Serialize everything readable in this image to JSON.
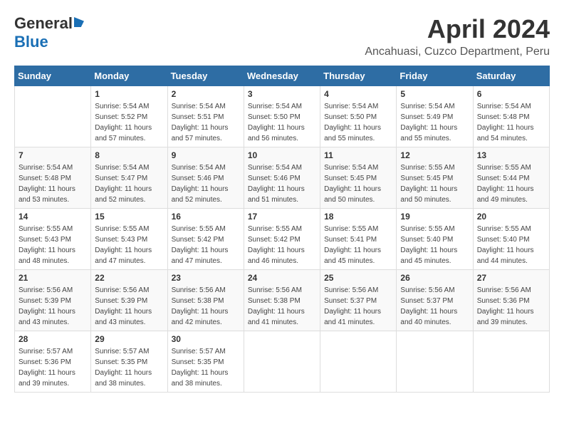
{
  "header": {
    "logo": {
      "part1": "General",
      "part2": "Blue"
    },
    "title": "April 2024",
    "location": "Ancahuasi, Cuzco Department, Peru"
  },
  "calendar": {
    "weekdays": [
      "Sunday",
      "Monday",
      "Tuesday",
      "Wednesday",
      "Thursday",
      "Friday",
      "Saturday"
    ],
    "weeks": [
      [
        {
          "day": null
        },
        {
          "day": 1,
          "sunrise": "5:54 AM",
          "sunset": "5:52 PM",
          "daylight": "11 hours and 57 minutes."
        },
        {
          "day": 2,
          "sunrise": "5:54 AM",
          "sunset": "5:51 PM",
          "daylight": "11 hours and 57 minutes."
        },
        {
          "day": 3,
          "sunrise": "5:54 AM",
          "sunset": "5:50 PM",
          "daylight": "11 hours and 56 minutes."
        },
        {
          "day": 4,
          "sunrise": "5:54 AM",
          "sunset": "5:50 PM",
          "daylight": "11 hours and 55 minutes."
        },
        {
          "day": 5,
          "sunrise": "5:54 AM",
          "sunset": "5:49 PM",
          "daylight": "11 hours and 55 minutes."
        },
        {
          "day": 6,
          "sunrise": "5:54 AM",
          "sunset": "5:48 PM",
          "daylight": "11 hours and 54 minutes."
        }
      ],
      [
        {
          "day": 7,
          "sunrise": "5:54 AM",
          "sunset": "5:48 PM",
          "daylight": "11 hours and 53 minutes."
        },
        {
          "day": 8,
          "sunrise": "5:54 AM",
          "sunset": "5:47 PM",
          "daylight": "11 hours and 52 minutes."
        },
        {
          "day": 9,
          "sunrise": "5:54 AM",
          "sunset": "5:46 PM",
          "daylight": "11 hours and 52 minutes."
        },
        {
          "day": 10,
          "sunrise": "5:54 AM",
          "sunset": "5:46 PM",
          "daylight": "11 hours and 51 minutes."
        },
        {
          "day": 11,
          "sunrise": "5:54 AM",
          "sunset": "5:45 PM",
          "daylight": "11 hours and 50 minutes."
        },
        {
          "day": 12,
          "sunrise": "5:55 AM",
          "sunset": "5:45 PM",
          "daylight": "11 hours and 50 minutes."
        },
        {
          "day": 13,
          "sunrise": "5:55 AM",
          "sunset": "5:44 PM",
          "daylight": "11 hours and 49 minutes."
        }
      ],
      [
        {
          "day": 14,
          "sunrise": "5:55 AM",
          "sunset": "5:43 PM",
          "daylight": "11 hours and 48 minutes."
        },
        {
          "day": 15,
          "sunrise": "5:55 AM",
          "sunset": "5:43 PM",
          "daylight": "11 hours and 47 minutes."
        },
        {
          "day": 16,
          "sunrise": "5:55 AM",
          "sunset": "5:42 PM",
          "daylight": "11 hours and 47 minutes."
        },
        {
          "day": 17,
          "sunrise": "5:55 AM",
          "sunset": "5:42 PM",
          "daylight": "11 hours and 46 minutes."
        },
        {
          "day": 18,
          "sunrise": "5:55 AM",
          "sunset": "5:41 PM",
          "daylight": "11 hours and 45 minutes."
        },
        {
          "day": 19,
          "sunrise": "5:55 AM",
          "sunset": "5:40 PM",
          "daylight": "11 hours and 45 minutes."
        },
        {
          "day": 20,
          "sunrise": "5:55 AM",
          "sunset": "5:40 PM",
          "daylight": "11 hours and 44 minutes."
        }
      ],
      [
        {
          "day": 21,
          "sunrise": "5:56 AM",
          "sunset": "5:39 PM",
          "daylight": "11 hours and 43 minutes."
        },
        {
          "day": 22,
          "sunrise": "5:56 AM",
          "sunset": "5:39 PM",
          "daylight": "11 hours and 43 minutes."
        },
        {
          "day": 23,
          "sunrise": "5:56 AM",
          "sunset": "5:38 PM",
          "daylight": "11 hours and 42 minutes."
        },
        {
          "day": 24,
          "sunrise": "5:56 AM",
          "sunset": "5:38 PM",
          "daylight": "11 hours and 41 minutes."
        },
        {
          "day": 25,
          "sunrise": "5:56 AM",
          "sunset": "5:37 PM",
          "daylight": "11 hours and 41 minutes."
        },
        {
          "day": 26,
          "sunrise": "5:56 AM",
          "sunset": "5:37 PM",
          "daylight": "11 hours and 40 minutes."
        },
        {
          "day": 27,
          "sunrise": "5:56 AM",
          "sunset": "5:36 PM",
          "daylight": "11 hours and 39 minutes."
        }
      ],
      [
        {
          "day": 28,
          "sunrise": "5:57 AM",
          "sunset": "5:36 PM",
          "daylight": "11 hours and 39 minutes."
        },
        {
          "day": 29,
          "sunrise": "5:57 AM",
          "sunset": "5:35 PM",
          "daylight": "11 hours and 38 minutes."
        },
        {
          "day": 30,
          "sunrise": "5:57 AM",
          "sunset": "5:35 PM",
          "daylight": "11 hours and 38 minutes."
        },
        {
          "day": null
        },
        {
          "day": null
        },
        {
          "day": null
        },
        {
          "day": null
        }
      ]
    ]
  }
}
